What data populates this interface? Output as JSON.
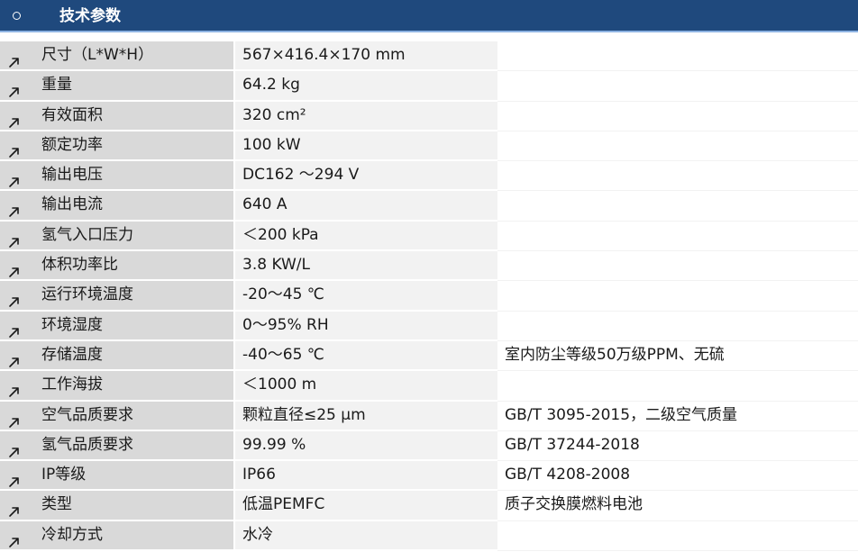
{
  "header": {
    "title": "技术参数"
  },
  "rows": [
    {
      "label": "尺寸（L*W*H）",
      "value": "567×416.4×170 mm",
      "note": ""
    },
    {
      "label": "重量",
      "value": "64.2 kg",
      "note": ""
    },
    {
      "label": "有效面积",
      "value": "320 cm²",
      "note": ""
    },
    {
      "label": "额定功率",
      "value": "100 kW",
      "note": ""
    },
    {
      "label": "输出电压",
      "value": "DC162 ～294 V",
      "note": ""
    },
    {
      "label": "输出电流",
      "value": "640 A",
      "note": ""
    },
    {
      "label": "氢气入口压力",
      "value": "＜200 kPa",
      "note": ""
    },
    {
      "label": "体积功率比",
      "value": "3.8 KW/L",
      "note": ""
    },
    {
      "label": "运行环境温度",
      "value": "-20～45 ℃",
      "note": ""
    },
    {
      "label": "环境湿度",
      "value": "0～95% RH",
      "note": ""
    },
    {
      "label": "存储温度",
      "value": "-40～65 ℃",
      "note": "室内防尘等级50万级PPM、无硫"
    },
    {
      "label": "工作海拔",
      "value": "＜1000 m",
      "note": ""
    },
    {
      "label": "空气品质要求",
      "value": "颗粒直径≤25 μm",
      "note": "GB/T 3095-2015，二级空气质量"
    },
    {
      "label": "氢气品质要求",
      "value": "99.99 %",
      "note": "GB/T 37244-2018"
    },
    {
      "label": "IP等级",
      "value": "IP66",
      "note": "GB/T 4208-2008"
    },
    {
      "label": "类型",
      "value": "低温PEMFC",
      "note": "质子交换膜燃料电池"
    },
    {
      "label": "冷却方式",
      "value": "水冷",
      "note": ""
    }
  ],
  "icons": {
    "header_bullet": "circle-bullet-icon",
    "row": "arrow-up-right-icon"
  },
  "colors": {
    "header_bg": "#1f497d",
    "header_border": "#8db3e2",
    "label_bg": "#d9d9d9",
    "value_bg": "#f2f2f2"
  }
}
